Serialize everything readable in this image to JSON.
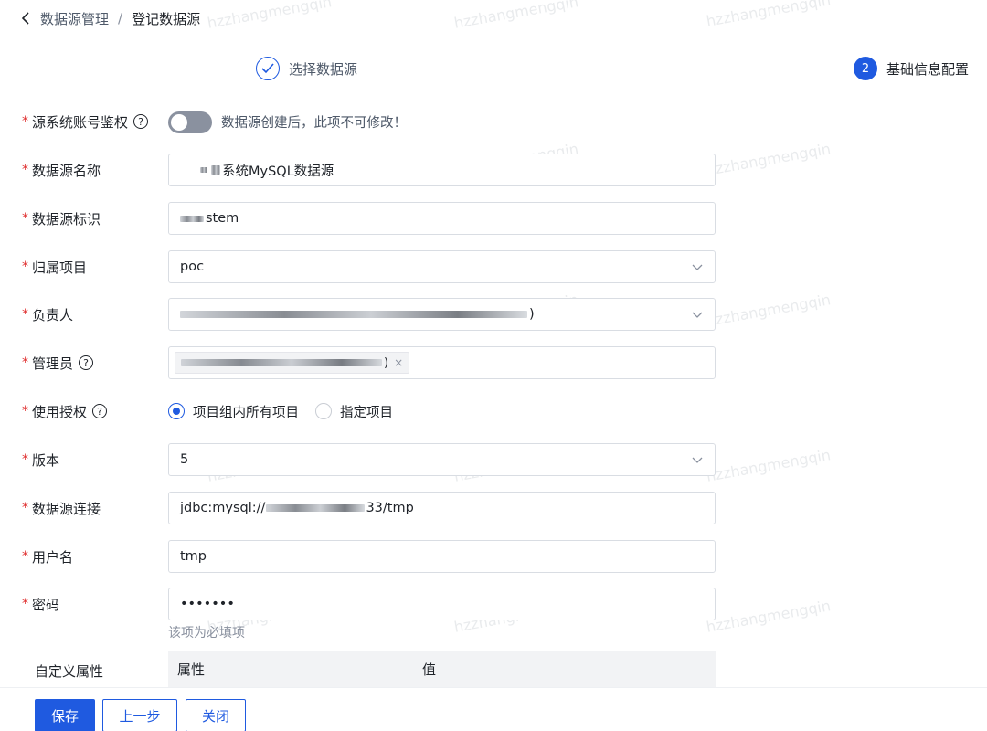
{
  "breadcrumb": {
    "parent": "数据源管理",
    "separator": "/",
    "current": "登记数据源"
  },
  "steps": {
    "step1": {
      "label": "选择数据源",
      "status": "done"
    },
    "step2": {
      "number": "2",
      "label": "基础信息配置",
      "status": "active"
    }
  },
  "form": {
    "auth": {
      "label": "源系统账号鉴权",
      "enabled": false,
      "hint": "数据源创建后，此项不可修改！"
    },
    "name": {
      "label": "数据源名称",
      "value": "系统MySQL数据源"
    },
    "identifier": {
      "label": "数据源标识",
      "value": "stem"
    },
    "project": {
      "label": "归属项目",
      "value": "poc"
    },
    "owner": {
      "label": "负责人",
      "value": ")"
    },
    "admin": {
      "label": "管理员",
      "tag": ")"
    },
    "usage": {
      "label": "使用授权",
      "options": [
        "项目组内所有项目",
        "指定项目"
      ],
      "selected": "项目组内所有项目"
    },
    "version": {
      "label": "版本",
      "value": "5"
    },
    "connection": {
      "label": "数据源连接",
      "prefix": "jdbc:mysql://",
      "suffix": "33/tmp"
    },
    "username": {
      "label": "用户名",
      "value": "tmp"
    },
    "password": {
      "label": "密码",
      "value": "•••••••",
      "hint": "该项为必填项"
    },
    "custom_props": {
      "label": "自定义属性",
      "columns": [
        "属性",
        "值"
      ]
    }
  },
  "buttons": {
    "save": "保存",
    "prev": "上一步",
    "close": "关闭"
  },
  "watermark": "hzzhangmengqin",
  "colors": {
    "primary": "#1f5ae0",
    "required": "#e02f2f",
    "toggle_off": "#8a919f",
    "table_header": "#f2f3f5"
  }
}
